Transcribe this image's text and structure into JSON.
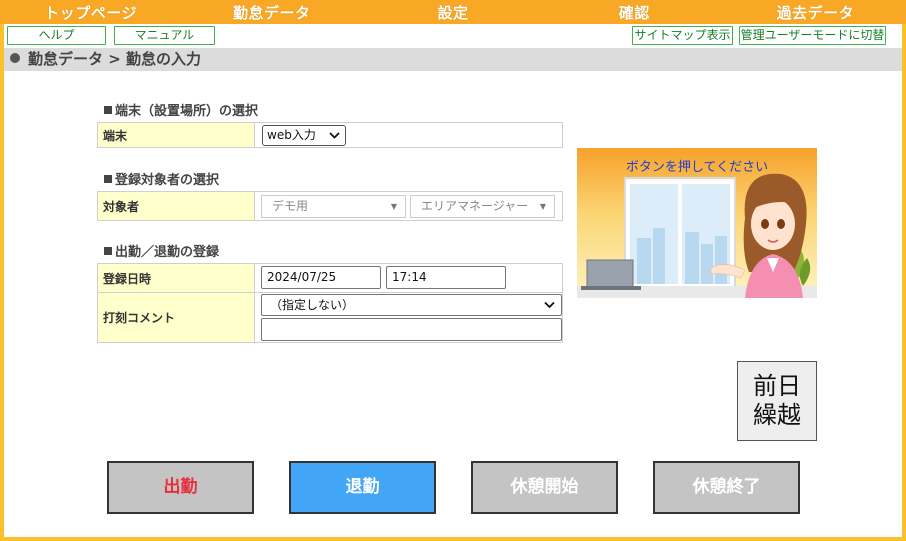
{
  "nav": {
    "items": [
      "トップページ",
      "勤怠データ",
      "設定",
      "確認",
      "過去データ"
    ]
  },
  "subnav": {
    "help": "ヘルプ",
    "manual": "マニュアル",
    "sitemap": "サイトマップ表示",
    "admin_mode": "管理ユーザーモードに切替"
  },
  "breadcrumb": "勤怠データ > 勤怠の入力",
  "sections": {
    "terminal": {
      "title": "端末（設置場所）の選択",
      "label": "端末",
      "selected": "web入力"
    },
    "target": {
      "title": "登録対象者の選択",
      "label": "対象者",
      "group_value": "デモ用",
      "person_value": "エリアマネージャー"
    },
    "punch": {
      "title": "出勤／退勤の登録",
      "datetime_label": "登録日時",
      "date_value": "2024/07/25",
      "time_value": "17:14",
      "comment_label": "打刻コメント",
      "comment_selected": "（指定しない）",
      "comment_text": ""
    }
  },
  "illustration": {
    "caption": "ボタンを押してください"
  },
  "prev_day": {
    "line1": "前日",
    "line2": "繰越"
  },
  "buttons": {
    "clock_in": "出勤",
    "clock_out": "退勤",
    "break_start": "休憩開始",
    "break_end": "休憩終了"
  },
  "colors": {
    "nav_bg": "#f9a825",
    "frame": "#fbc02d",
    "label_bg": "#ffffcc",
    "active_button": "#42a5f5",
    "clock_in_text": "#e8303c",
    "caption_text": "#1e3fd0"
  }
}
